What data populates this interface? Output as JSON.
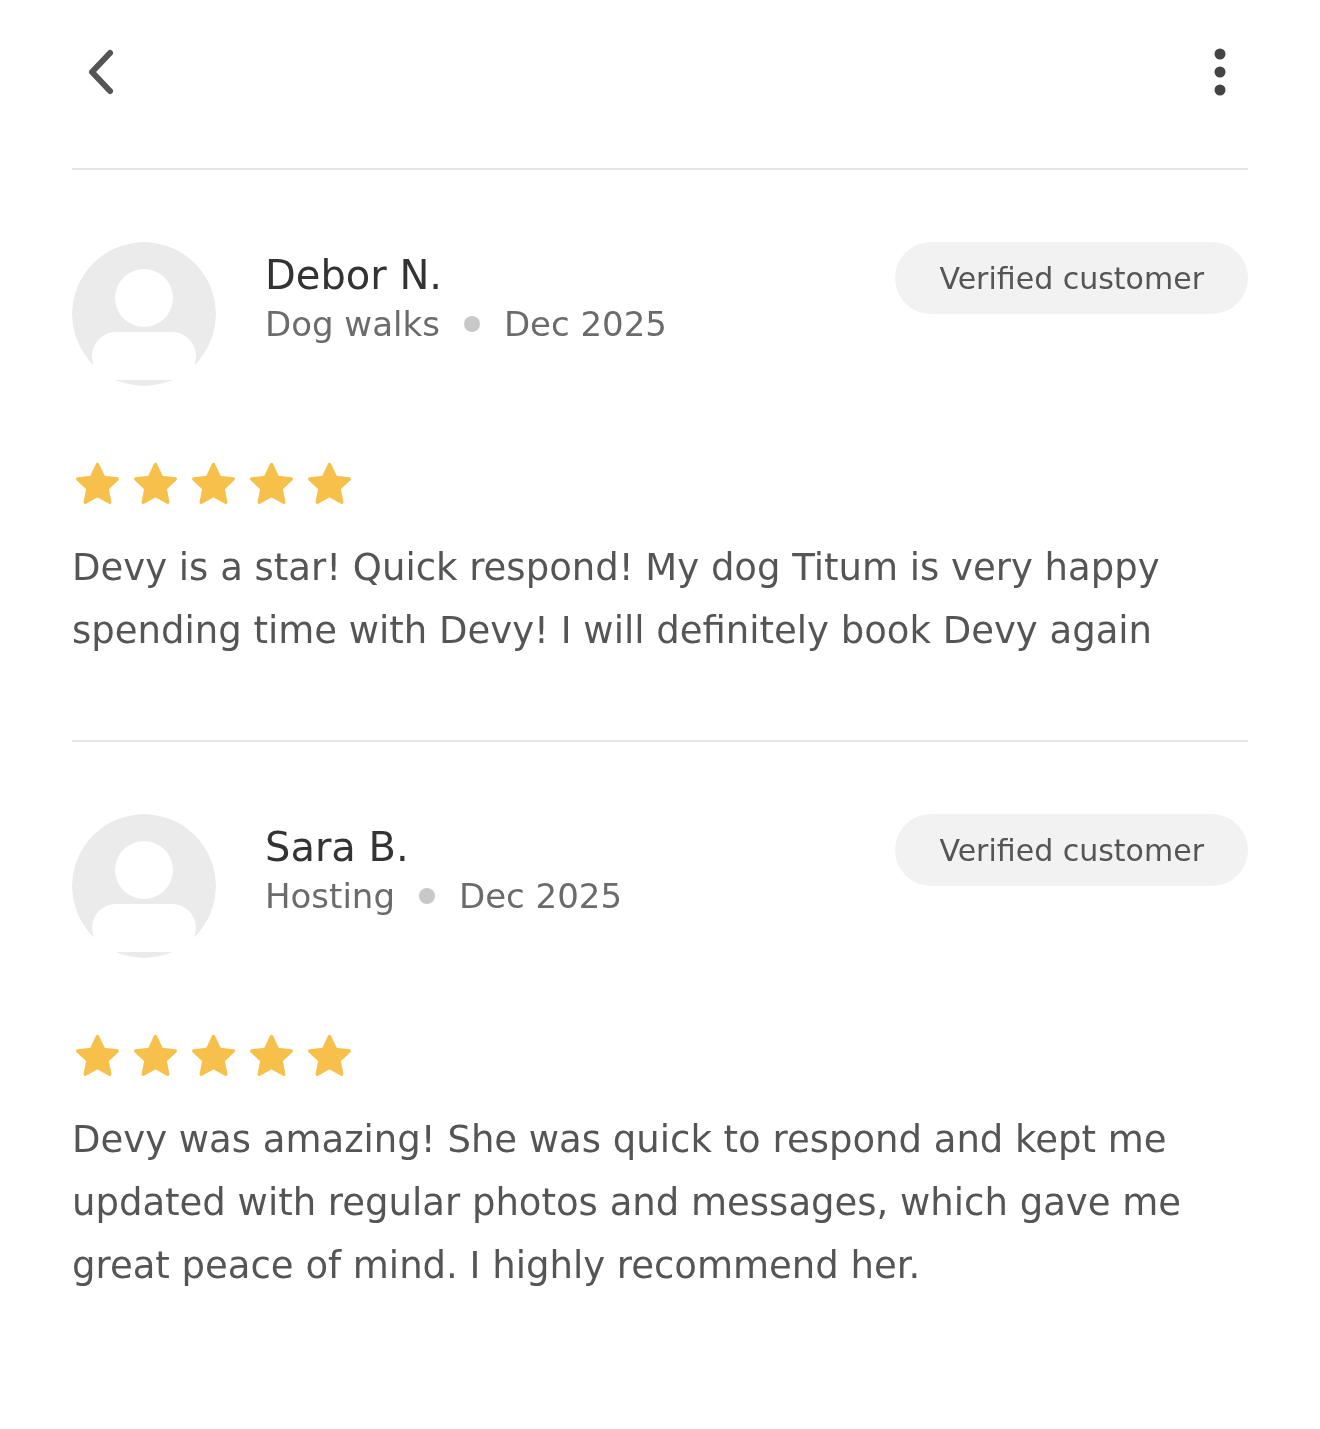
{
  "reviews": [
    {
      "name": "Debor N.",
      "service": "Dog walks",
      "date": "Dec 2025",
      "badge": "Verified customer",
      "stars": 5,
      "text": "Devy is a star! Quick respond! My dog Titum is very happy spending time with Devy! I will definitely book Devy again"
    },
    {
      "name": "Sara B.",
      "service": "Hosting",
      "date": "Dec 2025",
      "badge": "Verified customer",
      "stars": 5,
      "text": "Devy was amazing! She was quick to respond and kept me updated with regular photos and messages, which gave me great peace of mind. I highly recommend her."
    }
  ]
}
